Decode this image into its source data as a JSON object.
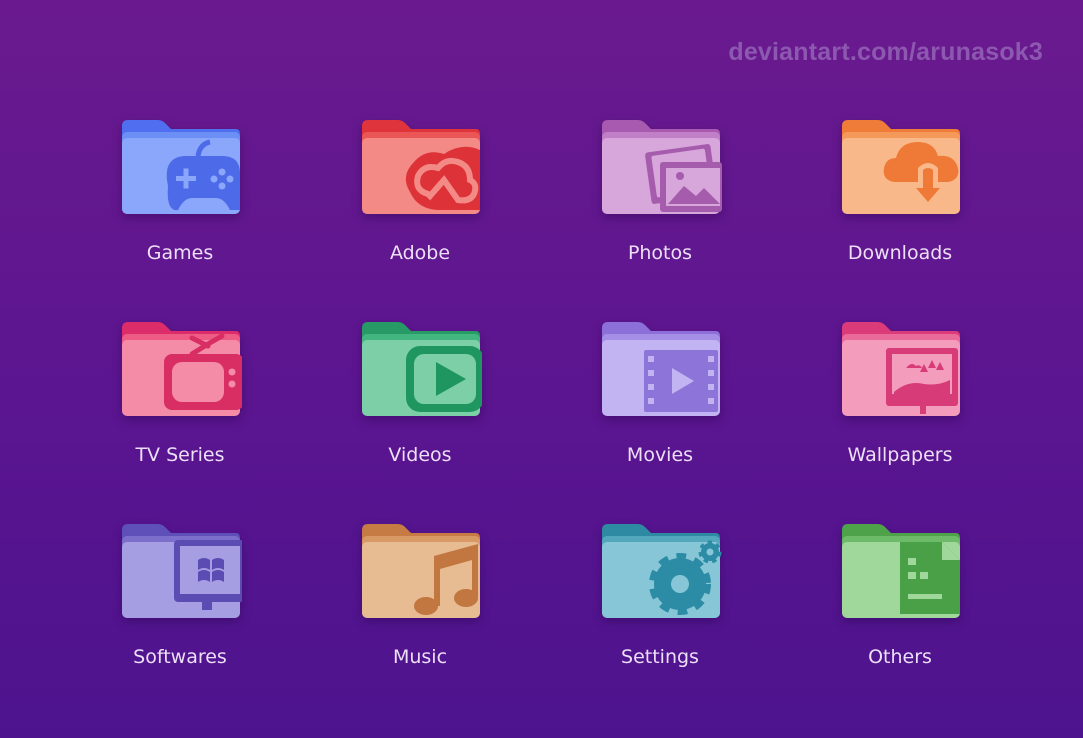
{
  "watermark": "deviantart.com/arunasok3",
  "folders": [
    {
      "label": "Games",
      "icon": "gamepad-icon",
      "tab": "#4f6ff0",
      "back": "#6b8ff5",
      "front": "#8ba7fb",
      "glyph": "#4d6ae8"
    },
    {
      "label": "Adobe",
      "icon": "adobe-cc-icon",
      "tab": "#e0343c",
      "back": "#ea5656",
      "front": "#f38a86",
      "glyph": "#dc3238"
    },
    {
      "label": "Photos",
      "icon": "photos-icon",
      "tab": "#a85ab0",
      "back": "#c07fc6",
      "front": "#d7a6da",
      "glyph": "#a65cac"
    },
    {
      "label": "Downloads",
      "icon": "cloud-download-icon",
      "tab": "#f07c3a",
      "back": "#f5995a",
      "front": "#f9b88a",
      "glyph": "#ef7a37"
    },
    {
      "label": "TV Series",
      "icon": "tv-icon",
      "tab": "#dc2d6a",
      "back": "#ee5c86",
      "front": "#f48ca8",
      "glyph": "#d82e64"
    },
    {
      "label": "Videos",
      "icon": "play-screen-icon",
      "tab": "#279a66",
      "back": "#43b581",
      "front": "#7ccfa6",
      "glyph": "#1f9660"
    },
    {
      "label": "Movies",
      "icon": "film-icon",
      "tab": "#8c6fd8",
      "back": "#a48ee6",
      "front": "#c2b4f2",
      "glyph": "#8d74d8"
    },
    {
      "label": "Wallpapers",
      "icon": "monitor-landscape-icon",
      "tab": "#dc3b7a",
      "back": "#ea6b9a",
      "front": "#f39cbb",
      "glyph": "#d73b78"
    },
    {
      "label": "Softwares",
      "icon": "windows-icon",
      "tab": "#5f4fb8",
      "back": "#7c6fcc",
      "front": "#a59ee2",
      "glyph": "#5b4cb4"
    },
    {
      "label": "Music",
      "icon": "music-note-icon",
      "tab": "#c77b44",
      "back": "#d89964",
      "front": "#e8bc92",
      "glyph": "#c27640"
    },
    {
      "label": "Settings",
      "icon": "gears-icon",
      "tab": "#2e8aa3",
      "back": "#52a7bd",
      "front": "#86c6d6",
      "glyph": "#2c8ba5"
    },
    {
      "label": "Others",
      "icon": "document-icon",
      "tab": "#4ea24a",
      "back": "#6dbb68",
      "front": "#a0d79a",
      "glyph": "#4aa046"
    }
  ]
}
